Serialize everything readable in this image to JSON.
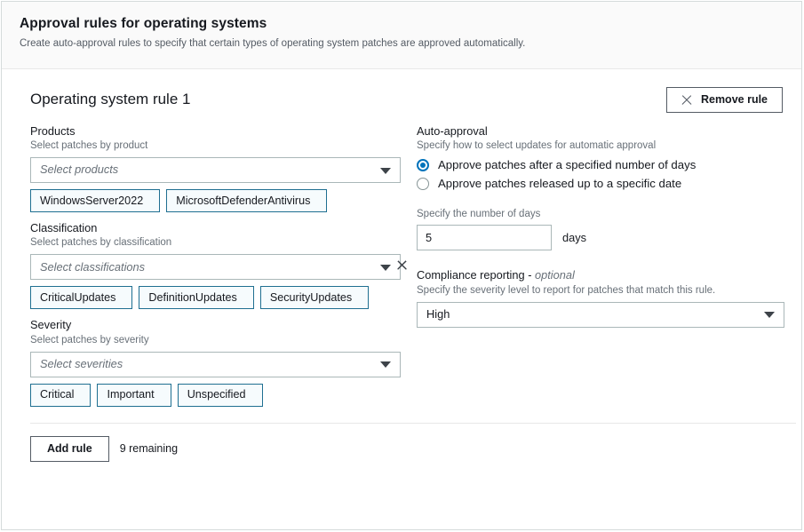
{
  "header": {
    "title": "Approval rules for operating systems",
    "subtitle": "Create auto-approval rules to specify that certain types of operating system patches are approved automatically."
  },
  "rule": {
    "title": "Operating system rule 1",
    "remove_button": "Remove rule",
    "remove_icon": "close-x-icon"
  },
  "products": {
    "label": "Products",
    "description": "Select patches by product",
    "placeholder": "Select products",
    "chevron_icon": "chevron-down-icon",
    "tokens": [
      "WindowsServer2022",
      "MicrosoftDefenderAntivirus"
    ]
  },
  "classification": {
    "label": "Classification",
    "description": "Select patches by classification",
    "placeholder": "Select classifications",
    "chevron_icon": "chevron-down-icon",
    "tokens": [
      "CriticalUpdates",
      "DefinitionUpdates",
      "SecurityUpdates"
    ]
  },
  "severity": {
    "label": "Severity",
    "description": "Select patches by severity",
    "placeholder": "Select severities",
    "chevron_icon": "chevron-down-icon",
    "tokens": [
      "Critical",
      "Important",
      "Unspecified"
    ]
  },
  "auto_approval": {
    "label": "Auto-approval",
    "description": "Specify how to select updates for automatic approval",
    "options": [
      {
        "label": "Approve patches after a specified number of days",
        "selected": true
      },
      {
        "label": "Approve patches released up to a specific date",
        "selected": false
      }
    ],
    "days_field_label": "Specify the number of days",
    "days_value": "5",
    "days_unit": "days"
  },
  "compliance": {
    "label": "Compliance reporting - ",
    "label_optional": "optional",
    "description": "Specify the severity level to report for patches that match this rule.",
    "value": "High",
    "chevron_icon": "chevron-down-icon"
  },
  "footer": {
    "add_rule_button": "Add rule",
    "remaining_text": "9 remaining"
  },
  "colors": {
    "accent_blue": "#0073bb",
    "token_border": "#1f6f91",
    "token_background": "#f6fbfd",
    "border_gray": "#aab7b8",
    "text_primary": "#16191f",
    "text_secondary": "#687078",
    "header_background": "#fafafa"
  }
}
